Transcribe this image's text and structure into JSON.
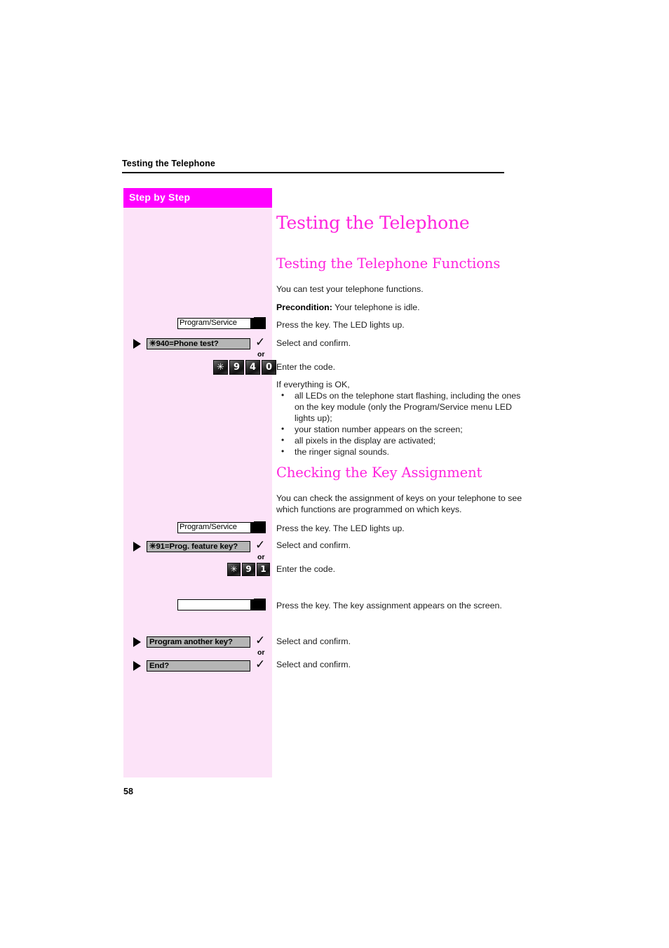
{
  "header": {
    "running_title": "Testing the Telephone"
  },
  "sidebar": {
    "banner_label": "Step by Step"
  },
  "chapter_title": "Testing the Telephone",
  "sections": [
    {
      "title": "Testing the Telephone Functions",
      "intro": "You can test your telephone functions.",
      "precondition_label": "Precondition:",
      "precondition_text": " Your telephone is idle.",
      "result_intro": "If everything is OK,",
      "bullets": [
        "all LEDs on the telephone start flashing, including the ones on the key module (only the Program/Service menu LED lights up);",
        "your station number appears on the screen;",
        "all pixels in the display are activated;",
        "the ringer signal sounds."
      ]
    },
    {
      "title": "Checking the Key Assignment",
      "intro": "You can check the assignment of keys on your telephone to see which functions are programmed on which keys."
    }
  ],
  "steps": [
    {
      "id": "program-service-1",
      "type": "function-key",
      "key_label": "Program/Service",
      "annotation": "Press the key. The LED lights up."
    },
    {
      "id": "phone-test",
      "type": "display-option",
      "display_text": "✳940=Phone test?",
      "annotation": "Select and confirm.",
      "or_label": "or"
    },
    {
      "id": "code-940",
      "type": "keypad",
      "keys": [
        "✳",
        "9",
        "4",
        "0"
      ],
      "annotation": "Enter the code."
    },
    {
      "id": "program-service-2",
      "type": "function-key",
      "key_label": "Program/Service",
      "annotation": "Press the key. The LED lights up."
    },
    {
      "id": "prog-feature-key",
      "type": "display-option",
      "display_text": "✳91=Prog. feature key?",
      "annotation": "Select and confirm.",
      "or_label": "or"
    },
    {
      "id": "code-91",
      "type": "keypad",
      "keys": [
        "✳",
        "9",
        "1"
      ],
      "annotation": "Enter the code."
    },
    {
      "id": "blank-key",
      "type": "function-key",
      "key_label": "",
      "annotation": "Press the key. The key assignment appears on the screen."
    },
    {
      "id": "program-another-key",
      "type": "display-option",
      "display_text": "Program another key?",
      "annotation": "Select and confirm.",
      "or_label": "or"
    },
    {
      "id": "end",
      "type": "display-option",
      "display_text": "End?",
      "annotation": "Select and confirm."
    }
  ],
  "page_number": "58",
  "colors": {
    "accent_magenta": "#ff00ff",
    "heading_pink": "#ff22dd",
    "panel_pink": "#fce3f8"
  }
}
